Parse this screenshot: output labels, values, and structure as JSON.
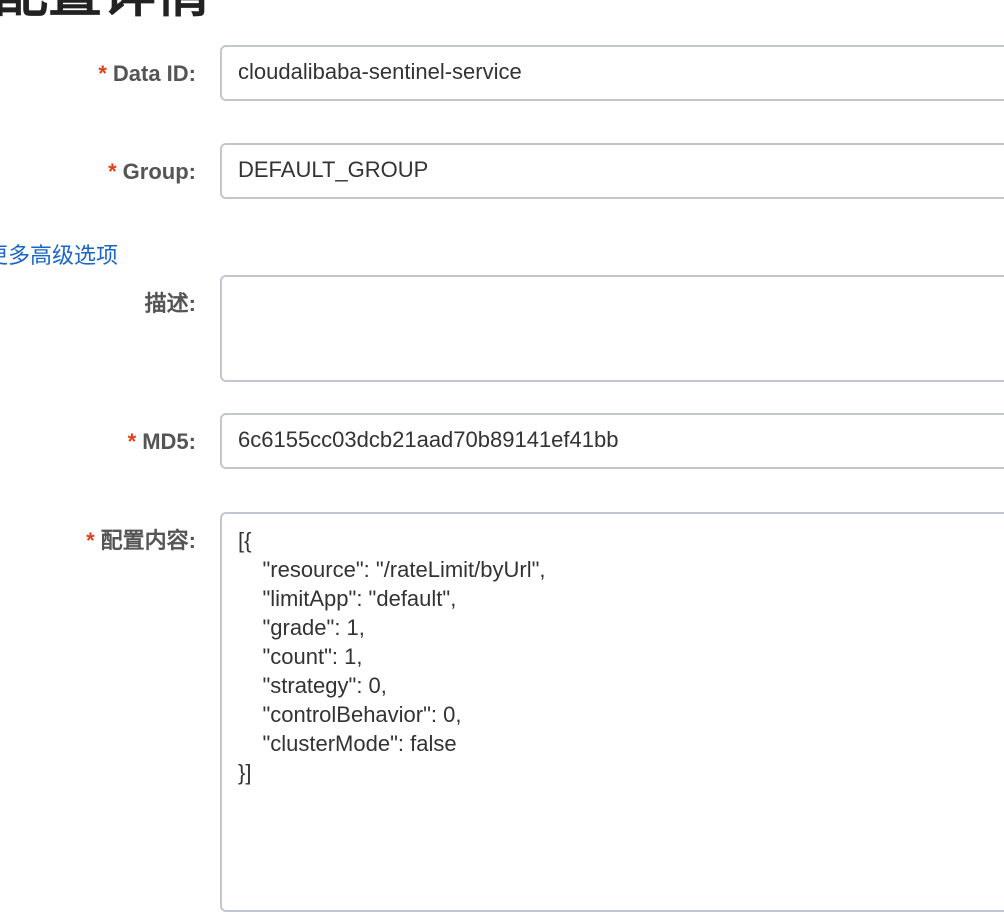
{
  "page": {
    "title": "配置详情"
  },
  "form": {
    "required_mark": "*",
    "data_id": {
      "label": "Data ID:",
      "value": "cloudalibaba-sentinel-service"
    },
    "group": {
      "label": "Group:",
      "value": "DEFAULT_GROUP"
    },
    "advanced_options_link": "更多高级选项",
    "description": {
      "label": "描述:",
      "value": ""
    },
    "md5": {
      "label": "MD5:",
      "value": "6c6155cc03dcb21aad70b89141ef41bb"
    },
    "content": {
      "label": "配置内容:",
      "lines": [
        "[{",
        "    \"resource\": \"/rateLimit/byUrl\",",
        "    \"limitApp\": \"default\",",
        "    \"grade\": 1,",
        "    \"count\": 1,",
        "    \"strategy\": 0,",
        "    \"controlBehavior\": 0,",
        "    \"clusterMode\": false",
        "}]"
      ]
    }
  },
  "colors": {
    "required": "#e0411a",
    "link": "#1a66c7",
    "border": "#c4c6cf",
    "label": "#555555"
  }
}
